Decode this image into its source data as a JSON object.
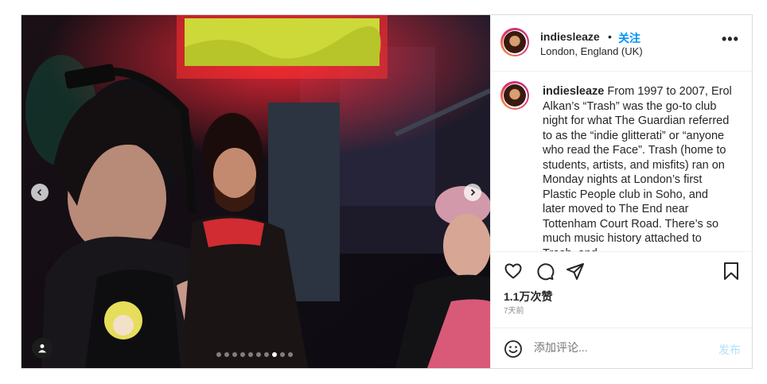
{
  "post": {
    "username": "indiesleaze",
    "follow_label": "关注",
    "separator": "•",
    "location": "London, England (UK)",
    "more_icon": "more-horizontal-icon",
    "caption_username": "indiesleaze",
    "caption_text": " From 1997 to 2007, Erol Alkan’s “Trash” was the go-to club night for what The Guardian referred to as the “indie glitterati” or “anyone who read the Face”. Trash (home to students, artists, and misfits) ran on Monday nights at London’s first Plastic People club in Soho, and later moved to The End near Tottenham Court Road. There’s so much music history attached to Trash, and",
    "likes": "1.1万次赞",
    "timestamp": "7天前",
    "comment_placeholder": "添加评论...",
    "post_label": "发布",
    "carousel": {
      "count": 10,
      "active_index": 7
    },
    "colors": {
      "accent": "#0095f6",
      "post_disabled": "#b2dffc",
      "text": "#262626",
      "muted": "#8e8e8e"
    }
  }
}
